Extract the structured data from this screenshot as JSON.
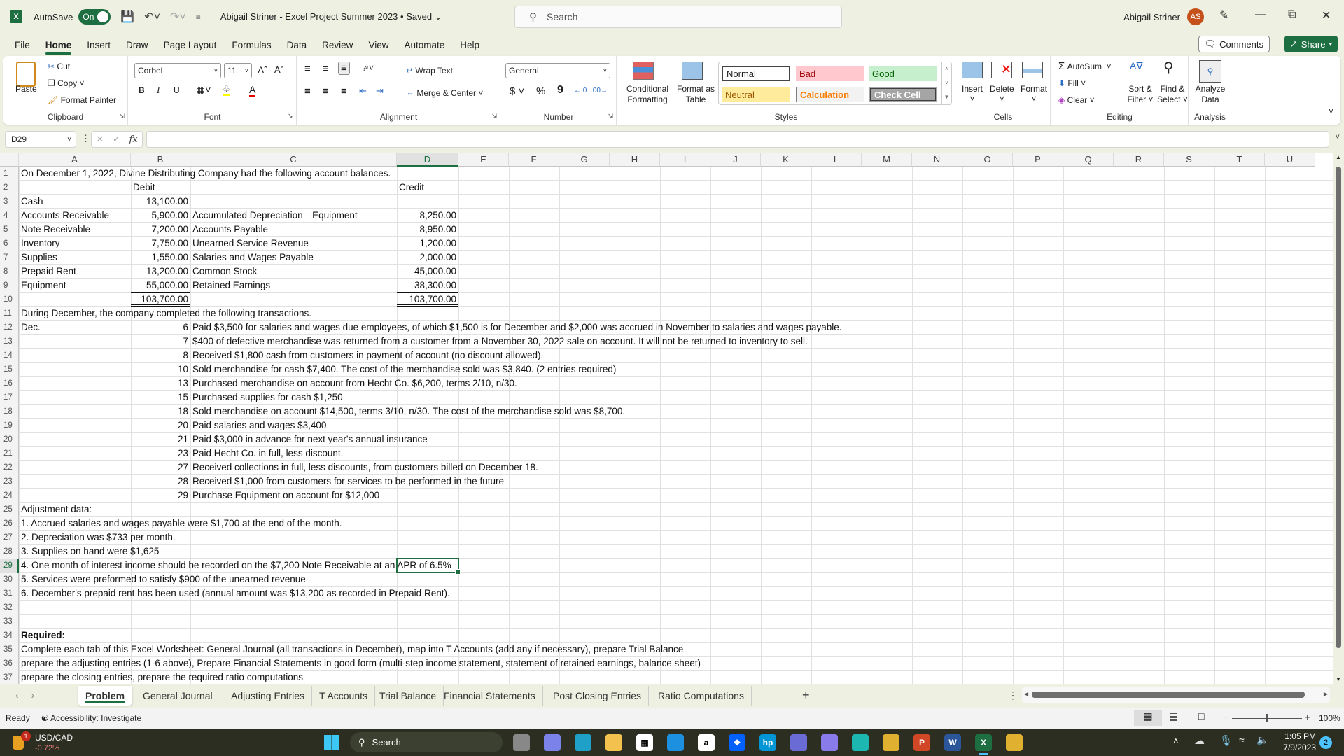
{
  "titlebar": {
    "app_icon": "X",
    "autosave_label": "AutoSave",
    "autosave_state": "On",
    "document_title": "Abigail Striner - Excel Project Summer 2023 • Saved",
    "search_placeholder": "Search",
    "user_name": "Abigail Striner",
    "user_initials": "AS"
  },
  "menu": {
    "tabs": [
      "File",
      "Home",
      "Insert",
      "Draw",
      "Page Layout",
      "Formulas",
      "Data",
      "Review",
      "View",
      "Automate",
      "Help"
    ],
    "active": "Home",
    "comments_label": "Comments",
    "share_label": "Share"
  },
  "ribbon": {
    "clipboard": {
      "label": "Clipboard",
      "paste": "Paste",
      "cut": "Cut",
      "copy": "Copy",
      "format_painter": "Format Painter"
    },
    "font": {
      "label": "Font",
      "font_name": "Corbel",
      "font_size": "11",
      "bold": "B",
      "italic": "I",
      "underline": "U"
    },
    "alignment": {
      "label": "Alignment",
      "wrap_text": "Wrap Text",
      "merge_center": "Merge & Center"
    },
    "number": {
      "label": "Number",
      "format": "General",
      "currency": "$",
      "percent": "%",
      "comma": "9"
    },
    "styles": {
      "label": "Styles",
      "conditional_formatting": "Conditional Formatting",
      "format_as_table": "Format as Table",
      "cells": [
        {
          "name": "Normal",
          "bg": "#ffffff",
          "fg": "#000000"
        },
        {
          "name": "Bad",
          "bg": "#ffc7ce",
          "fg": "#9c0006"
        },
        {
          "name": "Good",
          "bg": "#c6efce",
          "fg": "#006100"
        },
        {
          "name": "Neutral",
          "bg": "#ffeb9c",
          "fg": "#9c5700"
        },
        {
          "name": "Calculation",
          "bg": "#f2f2f2",
          "fg": "#fa7d00"
        },
        {
          "name": "Check Cell",
          "bg": "#a5a5a5",
          "fg": "#ffffff"
        }
      ]
    },
    "cells": {
      "label": "Cells",
      "insert": "Insert",
      "delete": "Delete",
      "format": "Format"
    },
    "editing": {
      "label": "Editing",
      "autosum": "AutoSum",
      "fill": "Fill",
      "clear": "Clear",
      "sort_filter": "Sort & Filter",
      "find_select": "Find & Select"
    },
    "analysis": {
      "label": "Analysis",
      "analyze_data": "Analyze Data"
    }
  },
  "formula_bar": {
    "name_box": "D29",
    "formula": ""
  },
  "sheet": {
    "columns": [
      "A",
      "B",
      "C",
      "D",
      "E",
      "F",
      "G",
      "H",
      "I",
      "J",
      "K",
      "L",
      "M",
      "N",
      "O",
      "P",
      "Q",
      "R",
      "S",
      "T",
      "U"
    ],
    "selected_column": "D",
    "selected_row": 29,
    "rows": [
      {
        "r": 1,
        "A": "On December 1, 2022, Divine Distributing Company had the following account balances."
      },
      {
        "r": 2,
        "B": "Debit",
        "D": "Credit"
      },
      {
        "r": 3,
        "A": "Cash",
        "B": "13,100.00"
      },
      {
        "r": 4,
        "A": "Accounts Receivable",
        "B": "5,900.00",
        "C": "Accumulated Depreciation—Equipment",
        "D": "8,250.00"
      },
      {
        "r": 5,
        "A": "Note Receivable",
        "B": "7,200.00",
        "C": "Accounts Payable",
        "D": "8,950.00"
      },
      {
        "r": 6,
        "A": "Inventory",
        "B": "7,750.00",
        "C": "Unearned Service Revenue",
        "D": "1,200.00"
      },
      {
        "r": 7,
        "A": "Supplies",
        "B": "1,550.00",
        "C": "Salaries and Wages Payable",
        "D": "2,000.00"
      },
      {
        "r": 8,
        "A": "Prepaid Rent",
        "B": "13,200.00",
        "C": "Common Stock",
        "D": "45,000.00"
      },
      {
        "r": 9,
        "A": "Equipment",
        "B": "55,000.00",
        "C": "Retained Earnings",
        "D": "38,300.00"
      },
      {
        "r": 10,
        "B": "103,700.00",
        "D": "103,700.00"
      },
      {
        "r": 11,
        "A": "During December, the company completed the following transactions."
      },
      {
        "r": 12,
        "A": "Dec.",
        "B": "6",
        "C": "Paid $3,500 for salaries and wages due employees, of which $1,500 is for December and $2,000 was accrued in November to salaries and wages payable."
      },
      {
        "r": 13,
        "B": "7",
        "C": "$400 of defective merchandise was returned from a customer from a November 30, 2022 sale on account. It will not be returned to inventory to sell."
      },
      {
        "r": 14,
        "B": "8",
        "C": "Received $1,800 cash from customers in payment of account (no discount allowed)."
      },
      {
        "r": 15,
        "B": "10",
        "C": "Sold merchandise for cash $7,400. The cost of the merchandise sold was $3,840. (2 entries required)"
      },
      {
        "r": 16,
        "B": "13",
        "C": "Purchased merchandise on account from Hecht Co. $6,200, terms 2/10, n/30."
      },
      {
        "r": 17,
        "B": "15",
        "C": "Purchased supplies for cash $1,250"
      },
      {
        "r": 18,
        "B": "18",
        "C": "Sold merchandise on account $14,500, terms 3/10, n/30. The cost of the merchandise sold was $8,700."
      },
      {
        "r": 19,
        "B": "20",
        "C": "Paid salaries and wages $3,400"
      },
      {
        "r": 20,
        "B": "21",
        "C": "Paid $3,000 in advance for next year's annual insurance"
      },
      {
        "r": 21,
        "B": "23",
        "C": "Paid Hecht Co. in full, less discount."
      },
      {
        "r": 22,
        "B": "27",
        "C": "Received collections in full, less discounts, from customers billed on December 18."
      },
      {
        "r": 23,
        "B": "28",
        "C": "Received $1,000 from customers for services to be performed in the future"
      },
      {
        "r": 24,
        "B": "29",
        "C": "Purchase Equipment on account for $12,000"
      },
      {
        "r": 25,
        "A": "Adjustment data:"
      },
      {
        "r": 26,
        "A": "1. Accrued salaries and wages payable were $1,700 at the end of the month."
      },
      {
        "r": 27,
        "A": "2. Depreciation was $733 per month."
      },
      {
        "r": 28,
        "A": "3. Supplies on hand were $1,625"
      },
      {
        "r": 29,
        "A": "4.  One month of interest income should be recorded on the $7,200 Note Receivable at an APR of 6.5%"
      },
      {
        "r": 30,
        "A": "5.  Services were preformed to satisfy $900 of the unearned revenue"
      },
      {
        "r": 31,
        "A": "6.  December's prepaid rent has been used (annual amount was $13,200 as recorded in Prepaid Rent)."
      },
      {
        "r": 32
      },
      {
        "r": 33
      },
      {
        "r": 34,
        "A": "Required:"
      },
      {
        "r": 35,
        "A": "Complete each tab of this Excel Worksheet:  General Journal (all transactions in December), map into T Accounts (add any if necessary), prepare Trial Balance"
      },
      {
        "r": 36,
        "A": "prepare the adjusting entries (1-6 above), Prepare Financial Statements in good form (multi-step income statement, statement of retained earnings, balance sheet)"
      },
      {
        "r": 37,
        "A": "prepare the closing entries, prepare the required ratio computations"
      }
    ]
  },
  "sheet_tabs": [
    "Problem",
    "General Journal",
    "Adjusting Entries",
    "T Accounts",
    "Trial Balance",
    "Financial Statements",
    "Post Closing Entries",
    "Ratio Computations"
  ],
  "active_sheet": "Problem",
  "status": {
    "ready": "Ready",
    "accessibility": "Accessibility: Investigate",
    "zoom": "100%",
    "zoom_fraction": 0.5
  },
  "taskbar": {
    "widget_title": "USD/CAD",
    "widget_value": "-0.72%",
    "widget_badge": "1",
    "search_label": "Search",
    "time": "1:05 PM",
    "date": "7/9/2023",
    "notification_count": "2",
    "apps": [
      "task-view",
      "teams",
      "edge",
      "file-explorer",
      "store",
      "mail",
      "amazon",
      "dropbox",
      "myhp",
      "copilot",
      "copilot-2",
      "app-bird",
      "chrome",
      "powerpoint",
      "word",
      "excel",
      "chrome-2"
    ]
  }
}
